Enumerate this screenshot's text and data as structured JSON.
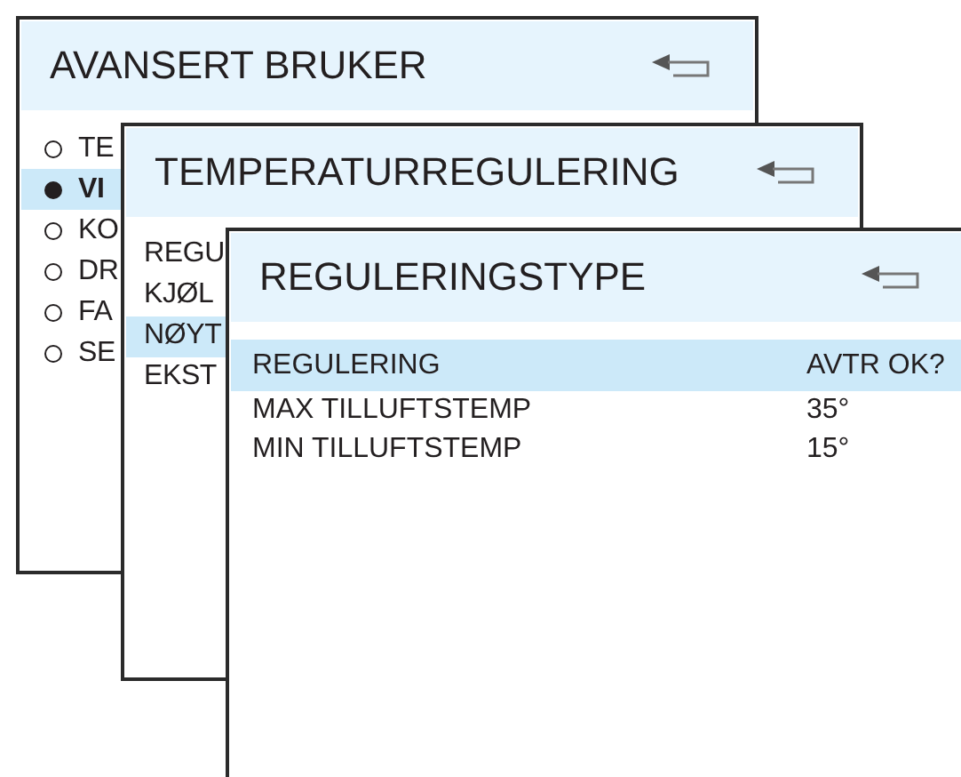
{
  "windows": [
    {
      "title": "AVANSERT BRUKER",
      "kind": "radio_list",
      "items": [
        {
          "label": "TE",
          "selected": false
        },
        {
          "label": "VI",
          "selected": true
        },
        {
          "label": "KO",
          "selected": false
        },
        {
          "label": "DR",
          "selected": false
        },
        {
          "label": "FA",
          "selected": false
        },
        {
          "label": "SE",
          "selected": false
        }
      ]
    },
    {
      "title": "TEMPERATURREGULERING",
      "kind": "list",
      "items": [
        {
          "label": "REGU",
          "selected": false
        },
        {
          "label": "KJØL",
          "selected": false
        },
        {
          "label": "NØYT",
          "selected": true
        },
        {
          "label": "EKST",
          "selected": false
        }
      ]
    },
    {
      "title": "REGULERINGSTYPE",
      "kind": "value_list",
      "items": [
        {
          "label": "REGULERING",
          "value": "AVTR OK?",
          "selected": true
        },
        {
          "label": "MAX TILLUFTSTEMP",
          "value": "35°",
          "selected": false
        },
        {
          "label": "MIN TILLUFTSTEMP",
          "value": "15°",
          "selected": false
        }
      ]
    }
  ]
}
